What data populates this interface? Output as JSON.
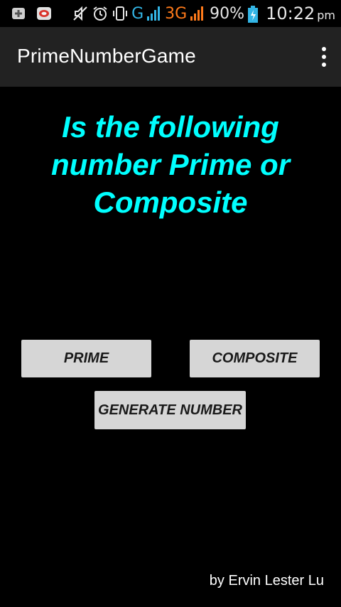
{
  "status_bar": {
    "network_g": "G",
    "network_3g": "3G",
    "battery_percent": "90%",
    "time": "10:22",
    "ampm": "pm",
    "icons": [
      "plus-square-icon",
      "app-notification-icon",
      "mute-icon",
      "alarm-icon",
      "phone-vibrate-icon",
      "signal-icon",
      "battery-charging-icon"
    ]
  },
  "action_bar": {
    "title": "PrimeNumberGame",
    "overflow_icon": "overflow-menu-icon"
  },
  "question": {
    "line1": "Is the following",
    "line2": "number Prime or",
    "line3": "Composite"
  },
  "buttons": {
    "prime": "PRIME",
    "composite": "COMPOSITE",
    "generate": "GENERATE NUMBER"
  },
  "footer": {
    "author": "by Ervin Lester Lu"
  },
  "colors": {
    "question_text": "#00ffff",
    "action_bar_bg": "#222222",
    "button_bg": "#d6d6d6",
    "network_g": "#33b5e5",
    "network_3g": "#ff7a1a"
  }
}
